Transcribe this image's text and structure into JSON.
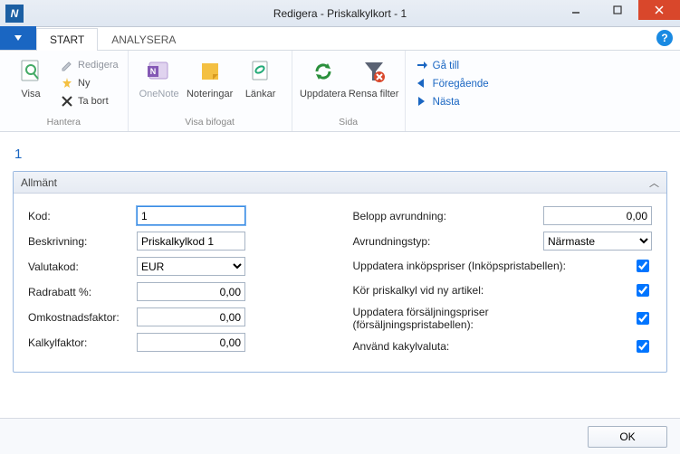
{
  "window": {
    "title": "Redigera - Priskalkylkort - 1"
  },
  "tabs": {
    "start": "START",
    "analysera": "ANALYSERA"
  },
  "ribbon": {
    "hantera": {
      "label": "Hantera",
      "visa": "Visa",
      "redigera": "Redigera",
      "ny": "Ny",
      "tabort": "Ta bort"
    },
    "bifogat": {
      "label": "Visa bifogat",
      "onenote": "OneNote",
      "noteringar": "Noteringar",
      "lankar": "Länkar"
    },
    "sida": {
      "label": "Sida",
      "uppdatera": "Uppdatera",
      "rensa": "Rensa filter"
    },
    "nav": {
      "gatill": "Gå till",
      "foregaende": "Föregående",
      "nasta": "Nästa"
    }
  },
  "docno": "1",
  "section": {
    "title": "Allmänt"
  },
  "fields": {
    "kod": {
      "label": "Kod:",
      "value": "1"
    },
    "beskrivning": {
      "label": "Beskrivning:",
      "value": "Priskalkylkod 1"
    },
    "valutakod": {
      "label": "Valutakod:",
      "value": "EUR"
    },
    "radrabatt": {
      "label": "Radrabatt %:",
      "value": "0,00"
    },
    "omkostnad": {
      "label": "Omkostnadsfaktor:",
      "value": "0,00"
    },
    "kalkyl": {
      "label": "Kalkylfaktor:",
      "value": "0,00"
    },
    "belopp": {
      "label": "Belopp avrundning:",
      "value": "0,00"
    },
    "avrund": {
      "label": "Avrundningstyp:",
      "value": "Närmaste"
    },
    "upink": {
      "label": "Uppdatera inköpspriser (Inköpspristabellen):"
    },
    "korpris": {
      "label": "Kör priskalkyl vid ny artikel:"
    },
    "upfors": {
      "label": "Uppdatera försäljningspriser (försäljningspristabellen):"
    },
    "kakyl": {
      "label": "Använd kakylvaluta:"
    }
  },
  "buttons": {
    "ok": "OK"
  }
}
